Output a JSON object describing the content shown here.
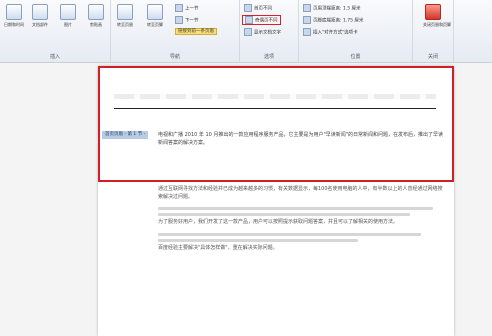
{
  "ribbon": {
    "groups": {
      "insert": {
        "label": "插入",
        "buttons": [
          "日期和时间",
          "文档部件",
          "图片",
          "剪贴画"
        ]
      },
      "navigation": {
        "label": "导航",
        "buttons": [
          "转至页眉",
          "转至页脚"
        ],
        "prev": "上一节",
        "next": "下一节",
        "link_prev": "链接到前一条页眉"
      },
      "options": {
        "label": "选项",
        "first_page": "首页不同",
        "odd_even": "奇偶页不同",
        "show_text": "显示文档文字"
      },
      "position": {
        "label": "位置",
        "header_top": "页眉顶端距离:",
        "header_value": "1.5 厘米",
        "footer_bottom": "页脚底端距离:",
        "footer_value": "1.75 厘米",
        "align_tab": "插入\"对齐方式\"选项卡"
      },
      "close": {
        "label": "关闭",
        "button": "关闭页眉和页脚"
      }
    }
  },
  "document": {
    "header_tag": "首页页眉 - 第 1 节 -",
    "header_text": "电视和广播 2010 年 10 月推出的一款应用程序服务产品，它主要是为用户\"早读新闻\"的日常新闻和问题，在发布后，推出了早读新闻答案的解决方案。",
    "paragraphs": [
      "通过互联网寻找方法和经验并已成为越来越多的习惯，有关数据显示，每100名使用电脑的人中，有半数以上的人曾经通过网络搜索解决过问题。",
      "为了服务好用户，我们开发了这一款产品，用户可以按照提示获取问题答案，并且可以了解相关的使用方法。",
      "百度经验主要解决\"具体怎样做\"，重在解决实际问题。"
    ]
  },
  "colors": {
    "highlight_red": "#d81f2a",
    "highlight_yellow": "#f7e07a"
  }
}
